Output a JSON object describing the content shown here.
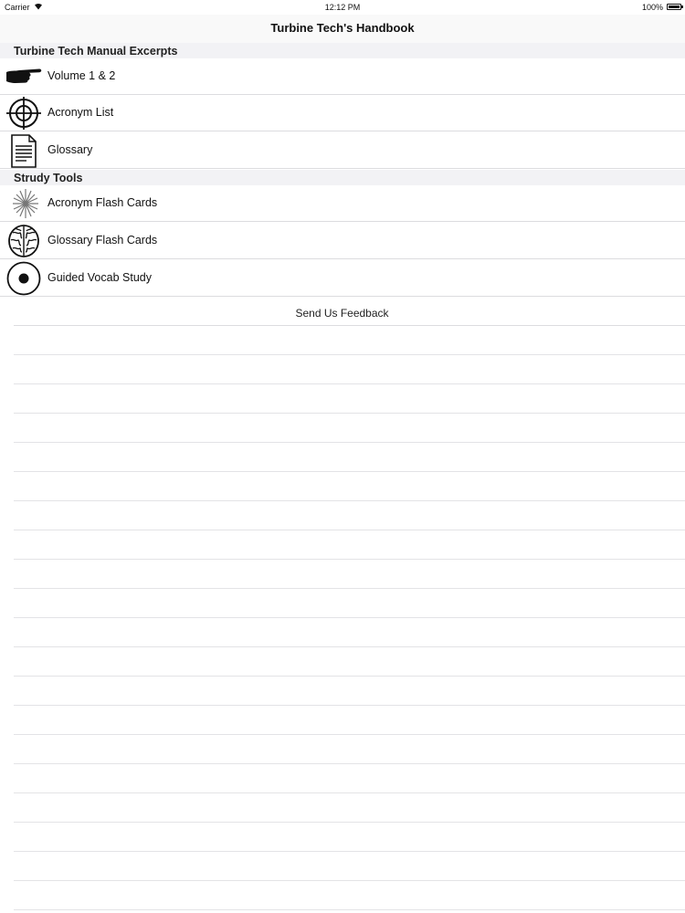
{
  "status_bar": {
    "carrier": "Carrier",
    "time": "12:12 PM",
    "battery": "100%"
  },
  "nav": {
    "title": "Turbine Tech's Handbook"
  },
  "sections": [
    {
      "header": "Turbine Tech Manual Excerpts",
      "items": [
        {
          "label": "Volume 1 & 2",
          "icon": "pointing-hand-icon"
        },
        {
          "label": "Acronym List",
          "icon": "crosshair-icon"
        },
        {
          "label": "Glossary",
          "icon": "document-icon"
        }
      ]
    },
    {
      "header": "Strudy Tools",
      "items": [
        {
          "label": "Acronym Flash Cards",
          "icon": "starburst-icon"
        },
        {
          "label": "Glossary Flash Cards",
          "icon": "brain-icon"
        },
        {
          "label": "Guided Vocab Study",
          "icon": "target-dot-icon"
        }
      ]
    }
  ],
  "feedback": {
    "label": "Send Us Feedback"
  },
  "colors": {
    "separator": "#dcdcdf",
    "section_bg": "#f2f2f5",
    "nav_bg": "#f9f9f9"
  }
}
